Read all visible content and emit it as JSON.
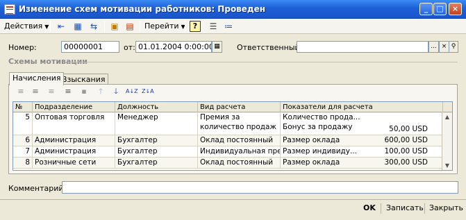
{
  "window": {
    "title": "Изменение схем мотивации работников: Проведен",
    "min_label": "_",
    "max_label": "□",
    "close_label": "×"
  },
  "toolbar": {
    "actions_label": "Действия",
    "goto_label": "Перейти",
    "help_label": "?"
  },
  "form": {
    "number_label": "Номер:",
    "number_value": "00000001",
    "date_label": "от:",
    "date_value": "01.01.2004  0:00:00",
    "responsible_label": "Ответственный:",
    "responsible_value": "",
    "dots_label": "...",
    "section_title": "Схемы мотивации",
    "comment_label": "Комментарий:",
    "comment_value": ""
  },
  "tabs": [
    {
      "label": "Начисления",
      "active": true
    },
    {
      "label": "Взыскания",
      "active": false
    }
  ],
  "table": {
    "columns": [
      "№",
      "Подразделение",
      "Должность",
      "Вид расчета",
      "Показатели для расчета"
    ],
    "rows": [
      {
        "num": "5",
        "department": "Оптовая торговля",
        "position": "Менеджер",
        "calc_type": "Премия за",
        "calc_type_2": "количество продаж",
        "indicator": "Количество прода...",
        "indicator_2": "Бонус за продажу",
        "amount": "",
        "amount_2": "50,00 USD"
      },
      {
        "num": "6",
        "department": "Администрация",
        "position": "Бухгалтер",
        "calc_type": "Оклад постоянный",
        "indicator": "Размер оклада",
        "amount": "600,00 USD"
      },
      {
        "num": "7",
        "department": "Администрация",
        "position": "Бухгалтер",
        "calc_type": "Индивидуальная пре...",
        "indicator": "Размер индивиду...",
        "amount": "100,00 USD"
      },
      {
        "num": "8",
        "department": "Розничные сети",
        "position": "Бухгалтер",
        "calc_type": "Оклад постоянный",
        "indicator": "Размер оклада",
        "amount": "300,00 USD"
      }
    ]
  },
  "footer": {
    "ok_label": "OK",
    "save_label": "Записать",
    "close_label": "Закрыть"
  }
}
